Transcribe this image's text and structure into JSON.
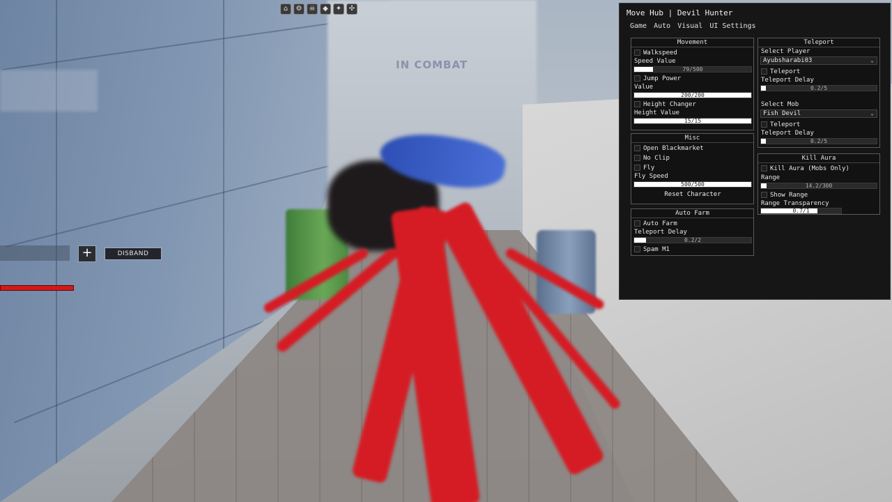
{
  "hud": {
    "combat_text": "IN COMBAT",
    "top_icons": [
      "home-icon",
      "gear-icon",
      "skull-icon",
      "shield-icon",
      "flame-icon",
      "arrows-icon"
    ],
    "party_plus": "+",
    "disband_label": "DISBAND"
  },
  "hub": {
    "title": "Move Hub | Devil Hunter",
    "tabs": [
      "Game",
      "Auto",
      "Visual",
      "UI Settings"
    ],
    "movement": {
      "title": "Movement",
      "walkspeed": "Walkspeed",
      "speed_value_label": "Speed Value",
      "speed_value": "79/500",
      "speed_fraction": 0.158,
      "jump_power": "Jump Power",
      "value_label": "Value",
      "jump_value": "200/200",
      "jump_fraction": 1.0,
      "height_changer": "Height Changer",
      "height_value_label": "Height Value",
      "height_value": "15/15",
      "height_fraction": 1.0
    },
    "misc": {
      "title": "Misc",
      "open_blackmarket": "Open Blackmarket",
      "no_clip": "No Clip",
      "fly": "Fly",
      "fly_speed_label": "Fly Speed",
      "fly_speed": "500/500",
      "fly_fraction": 1.0,
      "reset_character": "Reset Character"
    },
    "auto_farm": {
      "title": "Auto Farm",
      "auto_farm": "Auto Farm",
      "teleport_delay_label": "Teleport Delay",
      "teleport_delay": "0.2/2",
      "teleport_fraction": 0.1,
      "spam_m1": "Spam M1"
    },
    "teleport": {
      "title": "Teleport",
      "select_player_label": "Select Player",
      "selected_player": "Ayubsharabi03",
      "teleport_player": "Teleport",
      "player_delay_label": "Teleport Delay",
      "player_delay": "0.2/5",
      "player_delay_fraction": 0.04,
      "select_mob_label": "Select Mob",
      "selected_mob": "Fish Devil",
      "teleport_mob": "Teleport",
      "mob_delay_label": "Teleport Delay",
      "mob_delay": "0.2/5",
      "mob_delay_fraction": 0.04
    },
    "kill_aura": {
      "title": "Kill Aura",
      "kill_aura_mobs": "Kill Aura (Mobs Only)",
      "range_label": "Range",
      "range_value": "14.2/300",
      "range_fraction": 0.047,
      "show_range": "Show Range",
      "range_transparency_label": "Range Transparency",
      "range_transparency": "0.7/1",
      "transparency_fraction": 0.7
    }
  }
}
